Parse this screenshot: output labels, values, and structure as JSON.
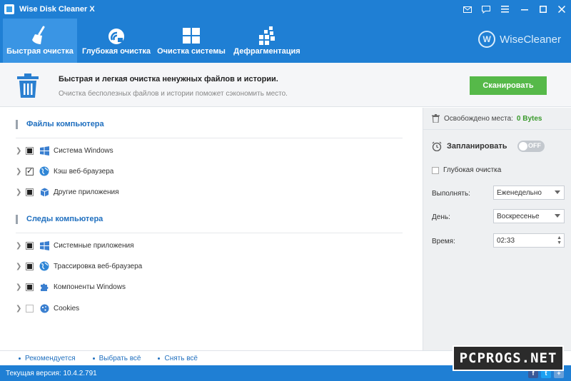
{
  "window": {
    "title": "Wise Disk Cleaner X",
    "controls": [
      "mail-icon",
      "feedback-icon",
      "menu-icon",
      "minimize-icon",
      "maximize-icon",
      "close-icon"
    ]
  },
  "toolbar": {
    "tabs": [
      {
        "label": "Быстрая очистка",
        "icon": "broom-icon",
        "active": true
      },
      {
        "label": "Глубокая очистка",
        "icon": "deep-clean-icon",
        "active": false
      },
      {
        "label": "Очистка системы",
        "icon": "windows-icon",
        "active": false
      },
      {
        "label": "Дефрагментация",
        "icon": "defrag-icon",
        "active": false
      }
    ],
    "brand": "WiseCleaner"
  },
  "header": {
    "title": "Быстрая и легкая очистка ненужных файлов и истории.",
    "subtitle": "Очистка бесполезных файлов и истории поможет сэкономить место.",
    "scan_label": "Сканировать"
  },
  "left": {
    "sections": [
      {
        "title": "Файлы компьютера",
        "items": [
          {
            "label": "Система Windows",
            "state": "partial",
            "icon": "windows-icon"
          },
          {
            "label": "Кэш веб-браузера",
            "state": "checked",
            "icon": "globe-icon"
          },
          {
            "label": "Другие приложения",
            "state": "partial",
            "icon": "box-icon"
          }
        ]
      },
      {
        "title": "Следы компьютера",
        "items": [
          {
            "label": "Системные приложения",
            "state": "partial",
            "icon": "windows-icon"
          },
          {
            "label": "Трассировка веб-браузера",
            "state": "partial",
            "icon": "globe-icon"
          },
          {
            "label": "Компоненты Windows",
            "state": "partial",
            "icon": "puzzle-icon"
          },
          {
            "label": "Cookies",
            "state": "empty",
            "icon": "cookie-icon"
          }
        ]
      }
    ]
  },
  "right": {
    "freed_label": "Освобождено места:",
    "freed_value": "0 Bytes",
    "schedule_label": "Запланировать",
    "toggle_label": "OFF",
    "deep_label": "Глубокая очистка",
    "run_label": "Выполнять:",
    "run_value": "Еженедельно",
    "day_label": "День:",
    "day_value": "Воскресенье",
    "time_label": "Время:",
    "time_value": "02:33"
  },
  "footer": {
    "links": [
      "Рекомендуется",
      "Выбрать всё",
      "Снять всё"
    ]
  },
  "status": {
    "version": "Текущая версия: 10.4.2.791"
  },
  "watermark": "PCPROGS.NET",
  "colors": {
    "accent": "#1f7fd4",
    "active_tab": "#3a95e4",
    "scan": "#56b949",
    "freed": "#3a9a2c"
  }
}
